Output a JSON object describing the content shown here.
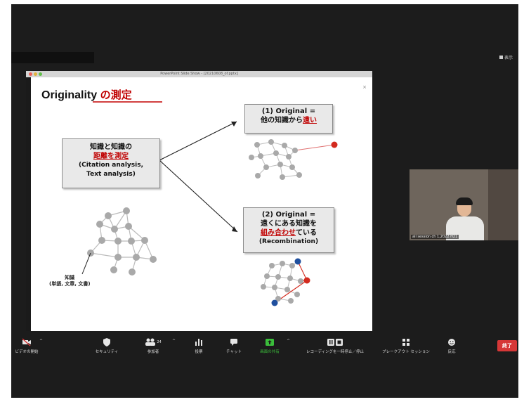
{
  "view_button": {
    "label": "表示"
  },
  "share_window": {
    "title": "PowerPoint Slide Show - [20210608_of.pptx]"
  },
  "slide": {
    "title_en": "Originality",
    "title_jp": "の測定",
    "box1": {
      "line1": "知識と知識の",
      "line2": "距離を測定",
      "line3": "(Citation analysis,",
      "line4": "Text analysis)"
    },
    "box2": {
      "line1": "(1) Original =",
      "line2_pre": "他の知識から",
      "line2_red": "遠い"
    },
    "box3": {
      "line1": "(2) Original =",
      "line2_pre": "遠くにある",
      "line2_red": "知識を",
      "line3_red": "組み合わせ",
      "line3_post": "ている",
      "line4": "(Recombination)"
    },
    "nodes_label": {
      "line1": "知識",
      "line2": "(単語, 文章, 文書)"
    }
  },
  "participant": {
    "name": "all session ch 1,2022 H21"
  },
  "toolbar": {
    "video": "ビデオの開始",
    "security": "セキュリティ",
    "participants": "参加者",
    "participants_count": "24",
    "polls": "投票",
    "chat": "チャット",
    "share": "画面の共有",
    "recording": "レコーディングを一時停止／停止",
    "breakout": "ブレークアウト セッション",
    "reactions": "反応",
    "end": "終了"
  },
  "colors": {
    "end_button": "#d63737",
    "share_active": "#3bbf3b",
    "slide_red": "#c00000"
  }
}
